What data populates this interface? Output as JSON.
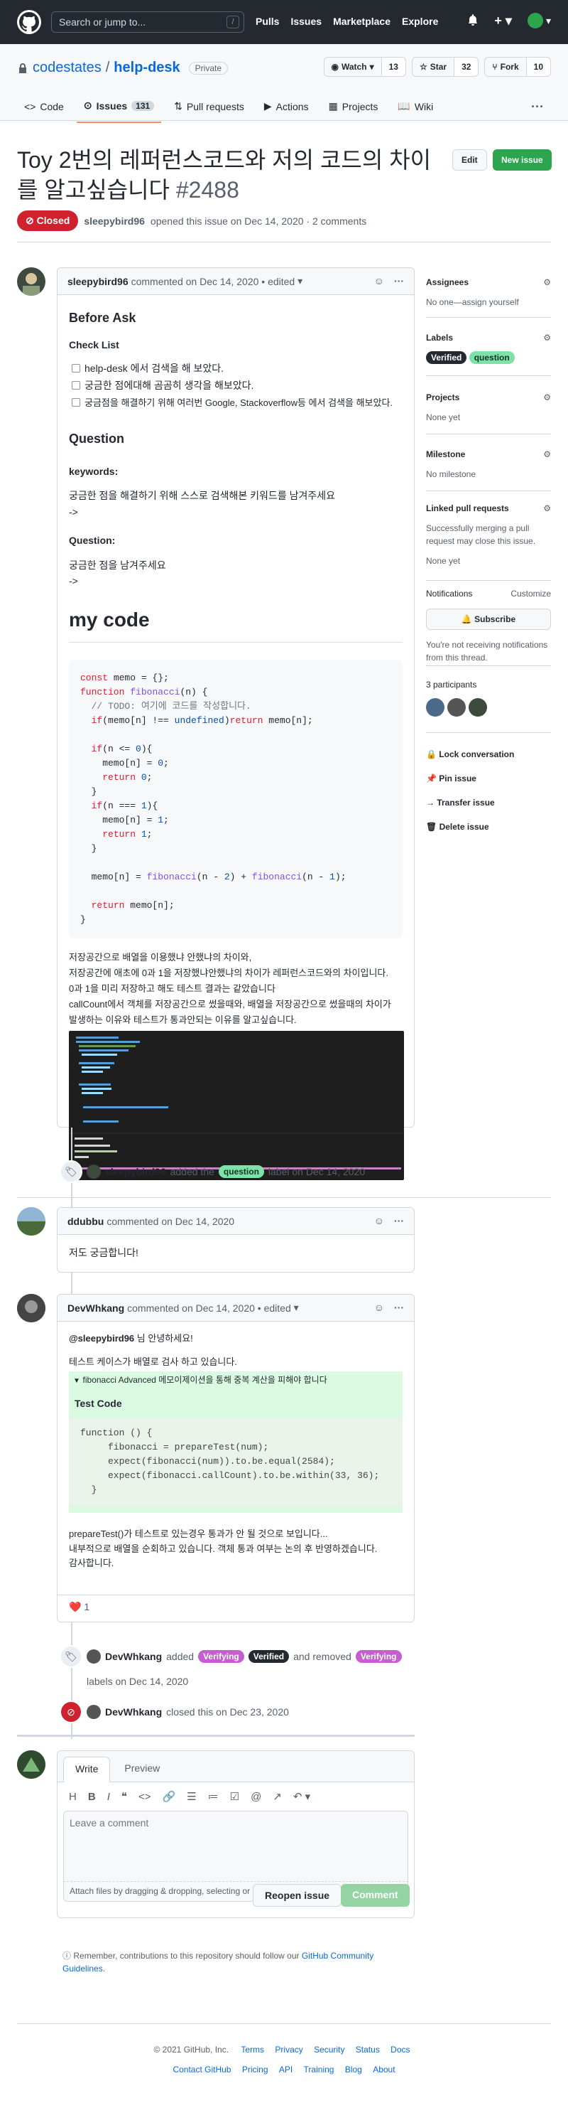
{
  "header": {
    "search_placeholder": "Search or jump to...",
    "slash": "/",
    "nav": [
      "Pulls",
      "Issues",
      "Marketplace",
      "Explore"
    ]
  },
  "repo": {
    "owner": "codestates",
    "sep": "/",
    "name": "help-desk",
    "visibility": "Private",
    "watch": "Watch",
    "watch_count": "13",
    "star": "Star",
    "star_count": "32",
    "fork": "Fork",
    "fork_count": "10",
    "tabs": [
      {
        "label": "Code"
      },
      {
        "label": "Issues",
        "count": "131"
      },
      {
        "label": "Pull requests"
      },
      {
        "label": "Actions"
      },
      {
        "label": "Projects"
      },
      {
        "label": "Wiki"
      }
    ]
  },
  "issue": {
    "title": "Toy 2번의 레퍼런스코드와 저의 코드의 차이를 알고싶습니다",
    "number": "#2488",
    "edit": "Edit",
    "new_issue": "New issue",
    "state": "Closed",
    "author": "sleepybird96",
    "opened_text": "opened this issue on Dec 14, 2020 · 2 comments"
  },
  "comment1": {
    "author": "sleepybird96",
    "meta": "commented on Dec 14, 2020",
    "edited": "• edited",
    "before_ask": "Before Ask",
    "check_list": "Check List",
    "checks": [
      "help-desk 에서 검색을 해 보았다.",
      "궁금한 점에대해 곰곰히 생각을 해보았다.",
      "궁금점을 해결하기 위해 여러번 Google, Stackoverflow등 에서 검색을 해보았다."
    ],
    "question": "Question",
    "keywords": "keywords:",
    "kw_text": "궁금한 점을 해결하기 위해 스스로 검색해본 키워드를 남겨주세요",
    "arrow": "->",
    "question2": "Question:",
    "q_text": "궁금한 점을 남겨주세요",
    "arrow2": "->",
    "mycode": "my code",
    "p1": "저장공간으로 배열을 이용했냐 안했냐의 차이와,",
    "p2": "저장공간에 애초에 0과 1을 저장했냐안했냐의 차이가 레퍼런스코드와의 차이입니다.",
    "p3": "0과 1을 미리 저장하고 해도 테스트 결과는 같았습니다",
    "p4": "callCount에서 객체를 저장공간으로 썼을때와, 배열을 저장공간으로 썼을때의 차이가",
    "p5": "발생하는 이유와 테스트가 통과안되는 이유를 알고싶습니다."
  },
  "event1": {
    "actor": "sleepybird96",
    "action": "added the",
    "label": "question",
    "suffix": "label on Dec 14, 2020"
  },
  "comment2": {
    "author": "ddubbu",
    "meta": "commented on Dec 14, 2020",
    "body": "저도 궁금합니다!"
  },
  "comment3": {
    "author": "DevWhkang",
    "meta": "commented on Dec 14, 2020",
    "edited": "• edited",
    "mention": "@sleepybird96",
    "greet": " 님 안녕하세요!",
    "line1": "테스트 케이스가 배열로 검사 하고 있습니다.",
    "summary": "fibonacci Advanced 메모이제이션을 통해 중복 계산을 피해야 합니다",
    "test_code": "Test Code",
    "p1": "prepareTest()가 테스트로 있는경우 통과가 안 될 것으로 보입니다...",
    "p2": "내부적으로 배열을 순회하고 있습니다. 객체 통과 여부는 논의 후 반영하겠습니다.",
    "p3": "감사합니다.",
    "reaction_count": "1"
  },
  "event2": {
    "actor": "DevWhkang",
    "added": "added",
    "l1": "Verifying",
    "l2": "Verified",
    "removed": "and removed",
    "l3": "Verifying",
    "suffix": "labels on Dec 14, 2020"
  },
  "event3": {
    "actor": "DevWhkang",
    "text": "closed this on Dec 23, 2020"
  },
  "newcomment": {
    "write": "Write",
    "preview": "Preview",
    "placeholder": "Leave a comment",
    "attach": "Attach files by dragging & dropping, selecting or pasting them.",
    "reopen": "Reopen issue",
    "submit": "Comment",
    "note": "Remember, contributions to this repository should follow our",
    "guidelines": "GitHub Community Guidelines",
    "period": "."
  },
  "sidebar": {
    "assignees": "Assignees",
    "assignees_val": "No one—assign yourself",
    "labels": "Labels",
    "label1": "Verified",
    "label2": "question",
    "projects": "Projects",
    "projects_val": "None yet",
    "milestone": "Milestone",
    "milestone_val": "No milestone",
    "linked": "Linked pull requests",
    "linked_text": "Successfully merging a pull request may close this issue.",
    "linked_val": "None yet",
    "notifications": "Notifications",
    "customize": "Customize",
    "subscribe": "Subscribe",
    "notif_text": "You're not receiving notifications from this thread.",
    "participants": "3 participants",
    "lock": "Lock conversation",
    "pin": "Pin issue",
    "transfer": "Transfer issue",
    "delete": "Delete issue"
  },
  "footer": {
    "copyright": "© 2021 GitHub, Inc.",
    "row1": [
      "Terms",
      "Privacy",
      "Security",
      "Status",
      "Docs"
    ],
    "row2": [
      "Contact GitHub",
      "Pricing",
      "API",
      "Training",
      "Blog",
      "About"
    ]
  },
  "colors": {
    "header": "#24292f",
    "closed": "#cf222e",
    "green": "#2da44e",
    "link": "#0969da",
    "label_verified": "#24292f",
    "label_question": "#7ee2a8",
    "label_verifying": "#c55ecf"
  }
}
